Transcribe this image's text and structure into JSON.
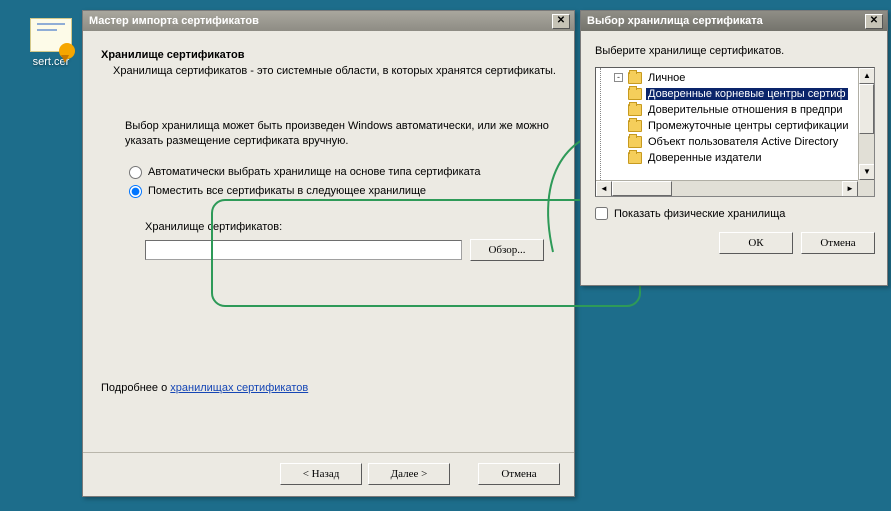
{
  "desktop": {
    "file_name": "sert.cer"
  },
  "wizard": {
    "title": "Мастер импорта сертификатов",
    "heading": "Хранилище сертификатов",
    "subheading": "Хранилища сертификатов - это системные области, в которых хранятся сертификаты.",
    "intro": "Выбор хранилища может быть произведен Windows автоматически, или же можно указать размещение сертификата вручную.",
    "radio_auto": "Автоматически выбрать хранилище на основе типа сертификата",
    "radio_place": "Поместить все сертификаты в следующее хранилище",
    "store_label": "Хранилище сертификатов:",
    "store_value": "",
    "browse": "Обзор...",
    "more_prefix": "Подробнее о ",
    "more_link": "хранилищах сертификатов",
    "back": "< Назад",
    "next": "Далее >",
    "cancel": "Отмена"
  },
  "selector": {
    "title": "Выбор хранилища сертификата",
    "prompt": "Выберите хранилище сертификатов.",
    "root_expander": "-",
    "items": [
      {
        "label": "Личное"
      },
      {
        "label": "Доверенные корневые центры сертиф",
        "selected": true
      },
      {
        "label": "Доверительные отношения в предпри"
      },
      {
        "label": "Промежуточные центры сертификации"
      },
      {
        "label": "Объект пользователя Active Directory"
      },
      {
        "label": "Доверенные издатели"
      }
    ],
    "show_physical": "Показать физические хранилища",
    "ok": "ОК",
    "cancel": "Отмена"
  }
}
